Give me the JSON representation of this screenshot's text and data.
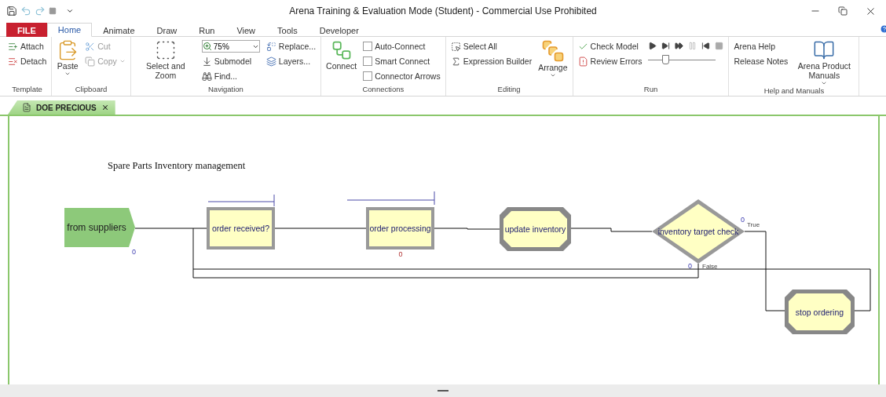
{
  "window": {
    "title": "Arena Training & Evaluation Mode (Student) - Commercial Use Prohibited"
  },
  "ribbon_tabs": [
    {
      "label": "FILE",
      "kind": "file",
      "selected": false
    },
    {
      "label": "Home",
      "kind": "tab",
      "selected": true
    },
    {
      "label": "Animate",
      "kind": "tab",
      "selected": false
    },
    {
      "label": "Draw",
      "kind": "tab",
      "selected": false
    },
    {
      "label": "Run",
      "kind": "tab",
      "selected": false
    },
    {
      "label": "View",
      "kind": "tab",
      "selected": false
    },
    {
      "label": "Tools",
      "kind": "tab",
      "selected": false
    },
    {
      "label": "Developer",
      "kind": "tab",
      "selected": false
    }
  ],
  "groups": [
    {
      "label": "Template",
      "columns": [
        [
          {
            "kind": "small",
            "label": "Attach"
          },
          {
            "kind": "small",
            "label": "Detach"
          }
        ]
      ]
    },
    {
      "label": "Clipboard",
      "columns": [
        [
          {
            "kind": "large",
            "label": "Paste",
            "dropdown": true
          }
        ],
        [
          {
            "kind": "small",
            "label": "Cut",
            "disabled": true
          },
          {
            "kind": "small",
            "label": "Copy",
            "disabled": true,
            "dropdown": true
          }
        ]
      ]
    },
    {
      "label": "Navigation",
      "columns": [
        [
          {
            "kind": "large",
            "label": "Select and Zoom"
          }
        ],
        [
          {
            "kind": "combo",
            "value": "75%"
          },
          {
            "kind": "small",
            "label": "Submodel"
          },
          {
            "kind": "small",
            "label": "Find..."
          }
        ],
        [
          {
            "kind": "small",
            "label": "Replace..."
          },
          {
            "kind": "small",
            "label": "Layers..."
          }
        ]
      ]
    },
    {
      "label": "Connections",
      "columns": [
        [
          {
            "kind": "large",
            "label": "Connect"
          }
        ],
        [
          {
            "kind": "checkbox",
            "label": "Auto-Connect",
            "checked": false
          },
          {
            "kind": "checkbox",
            "label": "Smart Connect",
            "checked": false
          },
          {
            "kind": "checkbox",
            "label": "Connector Arrows",
            "checked": false
          }
        ]
      ]
    },
    {
      "label": "Editing",
      "columns": [
        [
          {
            "kind": "small",
            "label": "Select All"
          },
          {
            "kind": "small",
            "label": "Expression Builder"
          }
        ],
        [
          {
            "kind": "large",
            "label": "Arrange",
            "dropdown": true
          }
        ]
      ]
    },
    {
      "label": "Run",
      "columns": [
        [
          {
            "kind": "small",
            "label": "Check Model"
          },
          {
            "kind": "small",
            "label": "Review Errors"
          }
        ],
        [
          {
            "kind": "transport",
            "level": 0.27
          }
        ]
      ]
    },
    {
      "label": "Help and Manuals",
      "columns": [
        [
          {
            "kind": "small",
            "label": "Arena Help"
          },
          {
            "kind": "small",
            "label": "Release Notes"
          }
        ],
        [
          {
            "kind": "large",
            "label": "Arena Product Manuals",
            "dropdown": true
          }
        ]
      ]
    }
  ],
  "document_tab": {
    "label": "DOE PRECIOUS",
    "selected": true
  },
  "diagram": {
    "title": "Spare Parts Inventory management",
    "modules": [
      {
        "kind": "create",
        "label": "from suppliers",
        "counter": "0"
      },
      {
        "kind": "process",
        "label": "order received?"
      },
      {
        "kind": "process",
        "label": "order processing",
        "counter": "0"
      },
      {
        "kind": "assign",
        "label": "update inventory"
      },
      {
        "kind": "decide",
        "label": "inventory target check",
        "counter": "0",
        "true_label": "True",
        "false_counter": "0",
        "false_label": "False"
      },
      {
        "kind": "assign",
        "label": "stop ordering"
      }
    ]
  }
}
